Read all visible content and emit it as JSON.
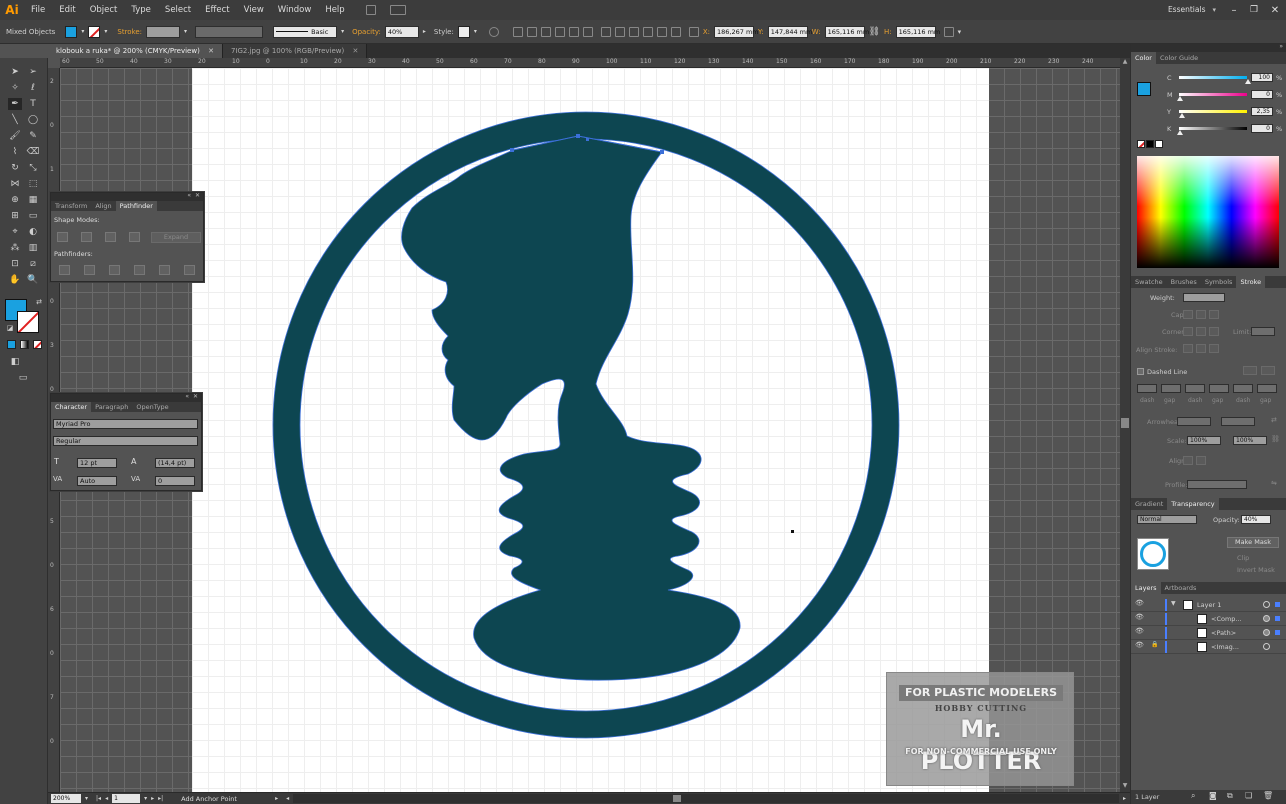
{
  "app": {
    "logo": "Ai"
  },
  "menu": [
    "File",
    "Edit",
    "Object",
    "Type",
    "Select",
    "Effect",
    "View",
    "Window",
    "Help"
  ],
  "workspace": "Essentials",
  "control_bar": {
    "selection": "Mixed Objects",
    "stroke_label": "Stroke:",
    "brush": "Basic",
    "opacity_label": "Opacity:",
    "opacity": "40%",
    "style_label": "Style:",
    "x_label": "X:",
    "x": "186,267 mm",
    "y_label": "Y:",
    "y": "147,844 mm",
    "w_label": "W:",
    "w": "165,116 mm",
    "h_label": "H:",
    "h": "165,116 mm",
    "fill_color": "#1aa1e0"
  },
  "doc_tabs": [
    "klobouk a ruka* @ 200% (CMYK/Preview)",
    "7IG2.jpg @ 100% (RGB/Preview)"
  ],
  "ruler_h": [
    "60",
    "50",
    "40",
    "30",
    "20",
    "10",
    "0",
    "10",
    "20",
    "30",
    "40",
    "50",
    "60",
    "70",
    "80",
    "90",
    "100",
    "110",
    "120",
    "130",
    "140",
    "150",
    "160",
    "170",
    "180",
    "190",
    "200",
    "210",
    "220",
    "230",
    "240"
  ],
  "ruler_v": [
    "2",
    "0",
    "1",
    "0",
    "2",
    "0",
    "3",
    "0",
    "4",
    "0",
    "5",
    "0",
    "6",
    "0",
    "7",
    "0"
  ],
  "pathfinder_panel": {
    "tabs": [
      "Transform",
      "Align",
      "Pathfinder"
    ],
    "shape_modes": "Shape Modes:",
    "expand": "Expand",
    "pathfinders": "Pathfinders:"
  },
  "character_panel": {
    "tabs": [
      "Character",
      "Paragraph",
      "OpenType"
    ],
    "font": "Myriad Pro",
    "style": "Regular",
    "size": "12 pt",
    "leading": "(14,4 pt)",
    "kerning": "Auto",
    "tracking": "0"
  },
  "color_panel": {
    "tabs": [
      "Color",
      "Color Guide"
    ],
    "channels": [
      {
        "label": "C",
        "value": "100",
        "level": 1.0
      },
      {
        "label": "M",
        "value": "0",
        "level": 0.0
      },
      {
        "label": "Y",
        "value": "2,35",
        "level": 0.0235
      },
      {
        "label": "K",
        "value": "0",
        "level": 0.0
      }
    ],
    "percent": "%"
  },
  "stroke_panel": {
    "tabs": [
      "Swatche",
      "Brushes",
      "Symbols",
      "Stroke"
    ],
    "weight_label": "Weight:",
    "cap_label": "Cap:",
    "corner_label": "Corner:",
    "limit_label": "Limit:",
    "align_label": "Align Stroke:",
    "dashed_label": "Dashed Line",
    "dash_labels": [
      "dash",
      "gap",
      "dash",
      "gap",
      "dash",
      "gap"
    ],
    "arrowheads_label": "Arrowheads:",
    "scale_label": "Scale:",
    "scale_a": "100%",
    "scale_b": "100%",
    "align2_label": "Align:",
    "profile_label": "Profile:"
  },
  "transparency_panel": {
    "tabs": [
      "Gradient",
      "Transparency"
    ],
    "mode": "Normal",
    "opacity_label": "Opacity:",
    "opacity": "40%",
    "make_mask": "Make Mask",
    "clip": "Clip",
    "invert_mask": "Invert Mask"
  },
  "layers_panel": {
    "tabs": [
      "Layers",
      "Artboards"
    ],
    "rows": [
      {
        "name": "Layer 1"
      },
      {
        "name": "<Comp..."
      },
      {
        "name": "<Path>"
      },
      {
        "name": "<Imag..."
      }
    ],
    "footer": "1 Layer"
  },
  "status_bar": {
    "zoom": "200%",
    "artboard": "1",
    "tool": "Add Anchor Point"
  },
  "watermark": {
    "line1": "FOR PLASTIC MODELERS",
    "line2": "HOBBY CUTTING",
    "line3": "Mr. PLOTTER",
    "line4": "FOR NON-COMMERCIAL USE ONLY"
  },
  "art_color": "#0d4651"
}
